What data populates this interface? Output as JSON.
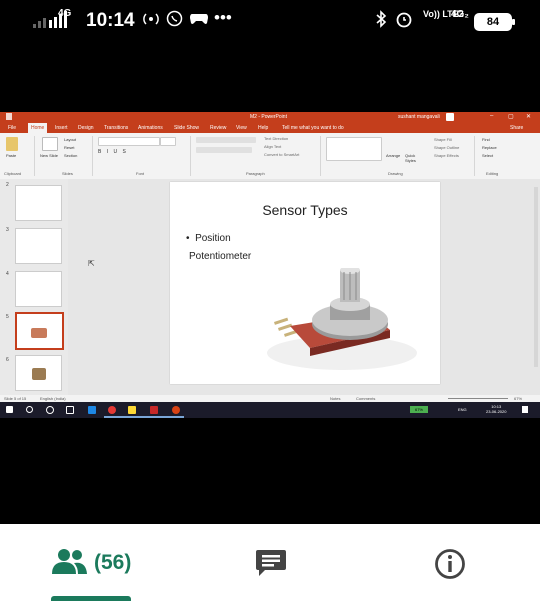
{
  "status_bar": {
    "signal_label": "4G",
    "time": "10:14",
    "volte_label": "Vo)) LTE2",
    "network_label": "4G₂",
    "battery": "84",
    "more_icon": "more-dots-icon"
  },
  "powerpoint": {
    "window_title": "M2 - PowerPoint",
    "user_name": "sushant mangavali",
    "tabs": [
      "File",
      "Home",
      "Insert",
      "Design",
      "Transitions",
      "Animations",
      "Slide Show",
      "Review",
      "View",
      "Help",
      "Tell me what you want to do"
    ],
    "share_label": "Share",
    "ribbon_groups": [
      "Clipboard",
      "Slides",
      "Font",
      "Paragraph",
      "Drawing",
      "Editing"
    ],
    "ribbon_buttons": {
      "paste": "Paste",
      "new_slide": "New Slide",
      "layout": "Layout",
      "reset": "Reset",
      "section": "Section",
      "arrange": "Arrange",
      "quick_styles": "Quick Styles",
      "shape_fill": "Shape Fill",
      "shape_outline": "Shape Outline",
      "shape_effects": "Shape Effects",
      "find": "Find",
      "replace": "Replace",
      "select": "Select",
      "text_direction": "Text Direction",
      "align_text": "Align Text",
      "convert_smartart": "Convert to SmartArt"
    },
    "thumbnail_numbers": [
      "2",
      "3",
      "4",
      "5",
      "6"
    ],
    "slide": {
      "title": "Sensor Types",
      "bullet": "Position",
      "subtext": "Potentiometer"
    },
    "status_left": "Slide 5 of 15",
    "status_lang": "English (India)",
    "status_notes": "Notes",
    "status_comments": "Comments",
    "zoom": "67%",
    "taskbar_battery": "67%",
    "taskbar_lang": "ENG",
    "taskbar_time": "10:13",
    "taskbar_date": "23-06-2020"
  },
  "bottom_nav": {
    "participants_count": "(56)",
    "people_icon": "people-icon",
    "chat_icon": "chat-icon",
    "info_icon": "info-icon"
  },
  "colors": {
    "accent": "#1b7a5c",
    "ppt_brand": "#c43e1c"
  }
}
